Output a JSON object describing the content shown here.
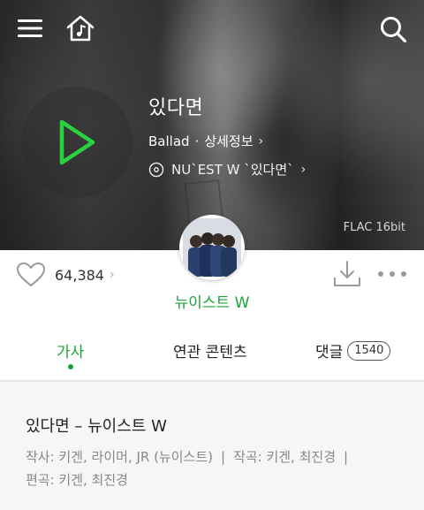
{
  "hero": {
    "song_title": "있다면",
    "genre": "Ballad",
    "dot": "·",
    "detail_link": "상세정보",
    "album": "NU`EST W `있다면`",
    "quality": "FLAC 16bit",
    "chevron": "›"
  },
  "icons": {
    "menu": "menu-icon",
    "home": "home-music-icon",
    "search": "search-icon",
    "play": "play-icon",
    "disc": "disc-icon",
    "heart": "heart-icon",
    "download": "download-icon",
    "more": "more-icon"
  },
  "actions": {
    "like_count": "64,384",
    "chevron": "›"
  },
  "artist": {
    "name": "뉴이스트 W"
  },
  "tabs": {
    "lyrics": "가사",
    "related": "연관 콘텐츠",
    "comments": "댓글",
    "comments_count": "1540"
  },
  "lyrics": {
    "heading": "있다면 – 뉴이스트 W",
    "lyricist": "작사: 키겐, 라이머, JR (뉴이스트)",
    "separator": "|",
    "composer": "작곡: 키겐, 최진경",
    "arranger": "편곡: 키겐, 최진경"
  },
  "colors": {
    "accent": "#1aa33b",
    "play": "#2bd23f"
  }
}
